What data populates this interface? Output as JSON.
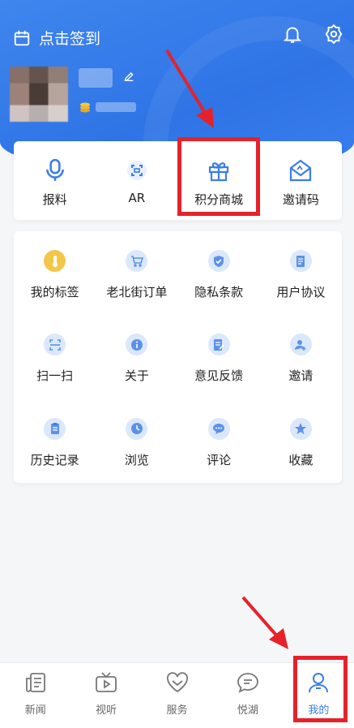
{
  "header": {
    "checkin_label": "点击签到",
    "bg_color": "#3578eb"
  },
  "quick_actions": [
    {
      "label": "报料",
      "icon": "microphone-icon"
    },
    {
      "label": "AR",
      "icon": "scan-frame-icon"
    },
    {
      "label": "积分商城",
      "icon": "gift-icon"
    },
    {
      "label": "邀请码",
      "icon": "envelope-icon"
    }
  ],
  "grid": [
    {
      "label": "我的标签",
      "icon": "tag-icon"
    },
    {
      "label": "老北街订单",
      "icon": "cart-icon"
    },
    {
      "label": "隐私条款",
      "icon": "shield-icon"
    },
    {
      "label": "用户协议",
      "icon": "document-icon"
    },
    {
      "label": "扫一扫",
      "icon": "scan-icon"
    },
    {
      "label": "关于",
      "icon": "info-icon"
    },
    {
      "label": "意见反馈",
      "icon": "feedback-icon"
    },
    {
      "label": "邀请",
      "icon": "add-user-icon"
    },
    {
      "label": "历史记录",
      "icon": "clipboard-icon"
    },
    {
      "label": "浏览",
      "icon": "clock-icon"
    },
    {
      "label": "评论",
      "icon": "chat-icon"
    },
    {
      "label": "收藏",
      "icon": "star-icon"
    }
  ],
  "tabs": [
    {
      "label": "新闻",
      "icon": "news-icon",
      "active": false
    },
    {
      "label": "视听",
      "icon": "tv-icon",
      "active": false
    },
    {
      "label": "服务",
      "icon": "heart-icon",
      "active": false
    },
    {
      "label": "悦湖",
      "icon": "chat-bubble-icon",
      "active": false
    },
    {
      "label": "我的",
      "icon": "user-icon",
      "active": true
    }
  ],
  "colors": {
    "accent": "#3b7de9",
    "annotation_red": "#e5222a"
  }
}
